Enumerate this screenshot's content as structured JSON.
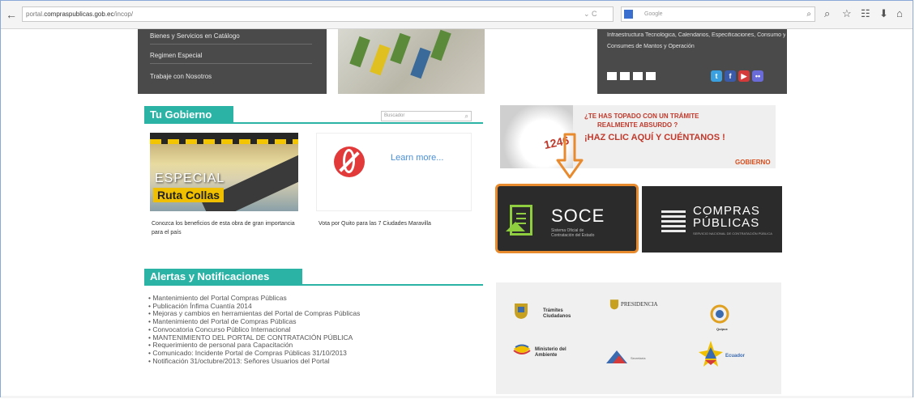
{
  "browser": {
    "url_prefix": "portal.",
    "url_domain": "compraspublicas.gob.ec",
    "url_path": "/incop/",
    "url_tools": "⌄ C",
    "search_placeholder": "Google",
    "back_glyph": "←",
    "icons": [
      "magnifier-icon",
      "star-icon",
      "bookmarks-icon",
      "download-icon",
      "home-icon"
    ]
  },
  "header_menu": {
    "items": [
      "Bienes y Servicios en Catálogo",
      "Regimen Especial",
      "Trabaje con Nosotros"
    ]
  },
  "header_right": {
    "line1": "Infraestructura Tecnológica, Calendarios, Especificaciones, Consumo y Aplicaciones e",
    "line2": "Consumes de Mantos y Operación",
    "social": [
      {
        "name": "twitter-icon",
        "glyph": "t",
        "color": "#3aa0e0"
      },
      {
        "name": "facebook-icon",
        "glyph": "f",
        "color": "#3b5ba8"
      },
      {
        "name": "youtube-icon",
        "glyph": "▶",
        "color": "#d43a3a"
      },
      {
        "name": "flickr-icon",
        "glyph": "••",
        "color": "#6a6ad8"
      }
    ]
  },
  "tu_gobierno": {
    "title": "Tu Gobierno",
    "search_placeholder": "Buscador",
    "card1": {
      "overlay_top": "ESPECIAL",
      "overlay_bottom": "Ruta Collas",
      "caption": "Conozca los beneficios de esta obra de gran importancia para el país"
    },
    "card2": {
      "link": "Learn more...",
      "caption": "Vota por Quito para las 7 Ciudades Maravilla"
    }
  },
  "alertas": {
    "title": "Alertas y Notificaciones",
    "items": [
      "Mantenimiento del Portal Compras Públicas",
      "Publicación Ínfima Cuantía 2014",
      "Mejoras y cambios en herramientas del Portal de Compras Públicas",
      "Mantenimiento del Portal de Compras Públicas",
      "Convocatoria Concurso Público Internacional",
      "MANTENIMIENTO DEL PORTAL DE CONTRATACIÓN PÚBLICA",
      "Requerimiento de personal para Capacitación",
      "Comunicado: Incidente Portal de Compras Públicas 31/10/2013",
      "Notificación 31/octubre/2013: Señores Usuarios del Portal"
    ]
  },
  "banner": {
    "line1": "¿TE HAS TOPADO CON UN TRÁMITE",
    "line2": "REALMENTE ABSURDO ?",
    "line3": "¡HAZ CLIC AQUÍ Y CUÉNTANOS !",
    "number": "1246",
    "logo": "GOBIERNO"
  },
  "soce": {
    "title": "SOCE",
    "subtitle": "Sistema Oficial de Contratación del Estado",
    "border_color": "#e88a2e"
  },
  "compras": {
    "line1": "COMPRAS",
    "line2": "PÚBLICAS",
    "subtitle": "SERVICIO NACIONAL DE CONTRATACIÓN PÚBLICA"
  },
  "partner_logos": [
    {
      "name": "tramites-ciudadanos-logo",
      "text": "Trámites Ciudadanos"
    },
    {
      "name": "presidencia-logo",
      "text": "PRESIDENCIA"
    },
    {
      "name": "quipux-logo",
      "text": "Quipux"
    },
    {
      "name": "ministerio-ambiente-logo",
      "text": "Ministerio del Ambiente"
    },
    {
      "name": "secretaria-logo",
      "text": "Secretaría"
    },
    {
      "name": "ecuador-logo",
      "text": "Ecuador"
    }
  ],
  "colors": {
    "accent": "#2bb3a6",
    "dark_panel": "#4a4a4a",
    "alert_red": "#c0392b",
    "soce_green": "#8fce3f"
  }
}
